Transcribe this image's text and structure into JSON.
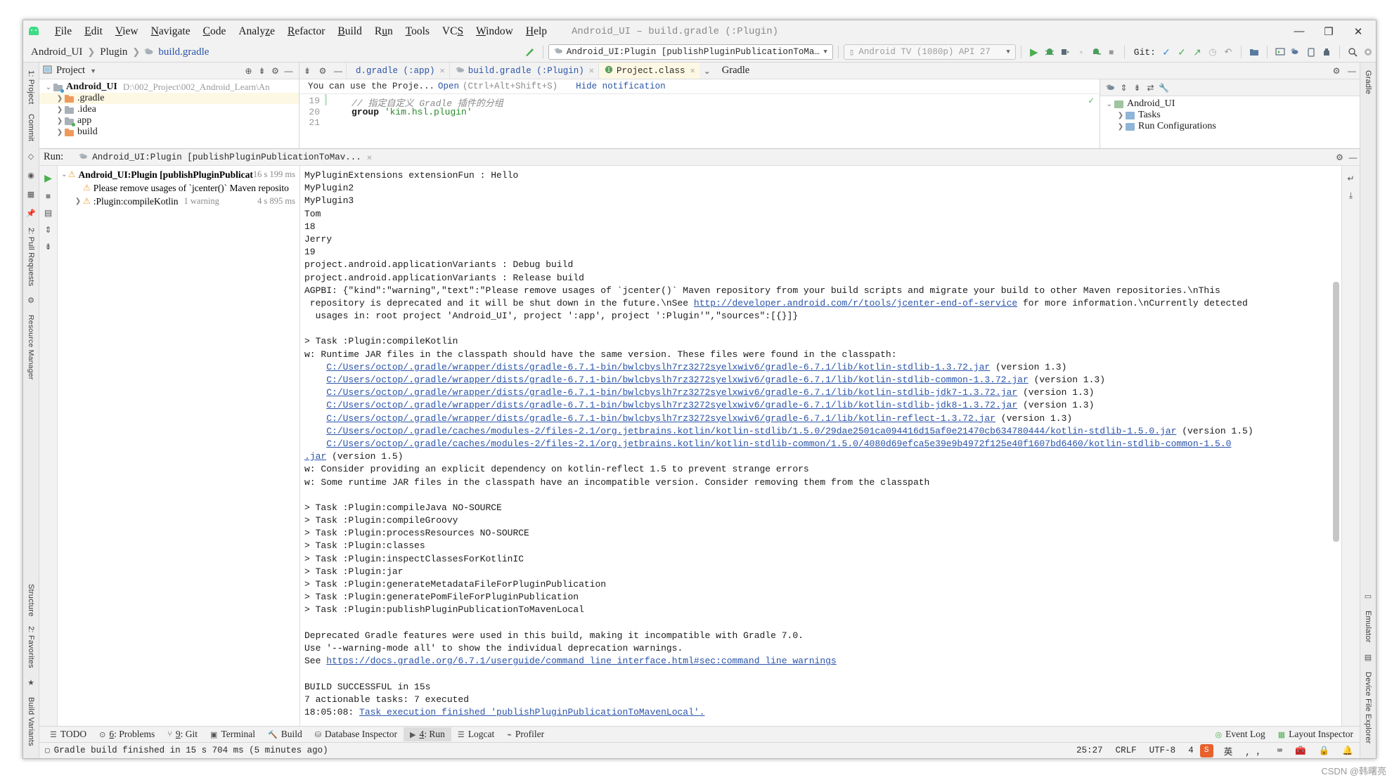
{
  "window": {
    "title": "Android_UI – build.gradle (:Plugin)",
    "minimize": "—",
    "maximize": "❐",
    "close": "✕"
  },
  "menu": {
    "items": [
      "File",
      "Edit",
      "View",
      "Navigate",
      "Code",
      "Analyze",
      "Refactor",
      "Build",
      "Run",
      "Tools",
      "VCS",
      "Window",
      "Help"
    ]
  },
  "navbar": {
    "breadcrumb": [
      "Android_UI",
      "Plugin",
      "build.gradle"
    ],
    "run_config": "Android_UI:Plugin [publishPluginPublicationToMavenLocal]",
    "device": "Android TV (1080p) API 27",
    "git_label": "Git:"
  },
  "project_pane": {
    "title": "Project",
    "tree": [
      {
        "label": "Android_UI",
        "path": "D:\\002_Project\\002_Android_Learn\\An",
        "bold": true,
        "expanded": true,
        "indent": 0,
        "folder": "module",
        "selected": false
      },
      {
        "label": ".gradle",
        "path": "",
        "bold": false,
        "expanded": false,
        "indent": 1,
        "folder": "orange",
        "selected": true
      },
      {
        "label": ".idea",
        "path": "",
        "bold": false,
        "expanded": false,
        "indent": 1,
        "folder": "plain",
        "selected": false
      },
      {
        "label": "app",
        "path": "",
        "bold": false,
        "expanded": false,
        "indent": 1,
        "folder": "module",
        "selected": false
      },
      {
        "label": "build",
        "path": "",
        "bold": false,
        "expanded": false,
        "indent": 1,
        "folder": "orange",
        "selected": false
      }
    ]
  },
  "editor": {
    "tabs": [
      {
        "label": "d.gradle (:app)",
        "icon": "gradle-icon",
        "active": false
      },
      {
        "label": "build.gradle (:Plugin)",
        "icon": "gradle-icon",
        "active": false
      },
      {
        "label": "Project.class",
        "icon": "class-icon",
        "active": true
      }
    ],
    "notification": {
      "text": "You can use the Proje...",
      "link": "Open",
      "shortcut": "(Ctrl+Alt+Shift+S)",
      "hide": "Hide notification"
    },
    "lines": [
      {
        "no": "19",
        "text": "// 指定自定义 Gradle 插件的分组",
        "type": "comment"
      },
      {
        "no": "20",
        "text": "group 'kim.hsl.plugin'",
        "type": "code"
      },
      {
        "no": "21",
        "text": "",
        "type": "code"
      }
    ]
  },
  "gradle_pane": {
    "title": "Gradle",
    "tree": [
      {
        "label": "Android_UI",
        "indent": 0,
        "icon": "elephant-icon"
      },
      {
        "label": "Tasks",
        "indent": 1,
        "icon": "folder-icon"
      },
      {
        "label": "Run Configurations",
        "indent": 1,
        "icon": "folder-icon"
      }
    ]
  },
  "run_panel": {
    "label": "Run:",
    "tab_title": "Android_UI:Plugin [publishPluginPublicationToMav...",
    "tree": [
      {
        "label": "Android_UI:Plugin [publishPluginPublicat",
        "time": "16 s 199 ms",
        "indent": 0,
        "warn": true,
        "expandable": true
      },
      {
        "label": "Please remove usages of `jcenter()` Maven reposito",
        "time": "",
        "indent": 1,
        "warn": true,
        "expandable": false
      },
      {
        "label": ":Plugin:compileKotlin",
        "warncount": "1 warning",
        "time": "4 s 895 ms",
        "indent": 1,
        "warn": true,
        "expandable": true
      }
    ],
    "console": [
      {
        "t": "MyPluginExtensions extensionFun : Hello"
      },
      {
        "t": "MyPlugin2"
      },
      {
        "t": "MyPlugin3"
      },
      {
        "t": "Tom"
      },
      {
        "t": "18"
      },
      {
        "t": "Jerry"
      },
      {
        "t": "19"
      },
      {
        "t": "project.android.applicationVariants : Debug build"
      },
      {
        "t": "project.android.applicationVariants : Release build"
      },
      {
        "t": "AGPBI: {\"kind\":\"warning\",\"text\":\"Please remove usages of `jcenter()` Maven repository from your build scripts and migrate your build to other Maven repositories.\\nThis"
      },
      {
        "t": " repository is deprecated and it will be shut down in the future.\\nSee ",
        "link": "http://developer.android.com/r/tools/jcenter-end-of-service",
        "after": " for more information.\\nCurrently detected"
      },
      {
        "t": "  usages in: root project 'Android_UI', project ':app', project ':Plugin'\",\"sources\":[{}]}"
      },
      {
        "t": ""
      },
      {
        "t": "> Task :Plugin:compileKotlin"
      },
      {
        "t": "w: Runtime JAR files in the classpath should have the same version. These files were found in the classpath:"
      },
      {
        "t": "    ",
        "link": "C:/Users/octop/.gradle/wrapper/dists/gradle-6.7.1-bin/bwlcbyslh7rz3272syelxwiv6/gradle-6.7.1/lib/kotlin-stdlib-1.3.72.jar",
        "after": " (version 1.3)"
      },
      {
        "t": "    ",
        "link": "C:/Users/octop/.gradle/wrapper/dists/gradle-6.7.1-bin/bwlcbyslh7rz3272syelxwiv6/gradle-6.7.1/lib/kotlin-stdlib-common-1.3.72.jar",
        "after": " (version 1.3)"
      },
      {
        "t": "    ",
        "link": "C:/Users/octop/.gradle/wrapper/dists/gradle-6.7.1-bin/bwlcbyslh7rz3272syelxwiv6/gradle-6.7.1/lib/kotlin-stdlib-jdk7-1.3.72.jar",
        "after": " (version 1.3)"
      },
      {
        "t": "    ",
        "link": "C:/Users/octop/.gradle/wrapper/dists/gradle-6.7.1-bin/bwlcbyslh7rz3272syelxwiv6/gradle-6.7.1/lib/kotlin-stdlib-jdk8-1.3.72.jar",
        "after": " (version 1.3)"
      },
      {
        "t": "    ",
        "link": "C:/Users/octop/.gradle/wrapper/dists/gradle-6.7.1-bin/bwlcbyslh7rz3272syelxwiv6/gradle-6.7.1/lib/kotlin-reflect-1.3.72.jar",
        "after": " (version 1.3)"
      },
      {
        "t": "    ",
        "link": "C:/Users/octop/.gradle/caches/modules-2/files-2.1/org.jetbrains.kotlin/kotlin-stdlib/1.5.0/29dae2501ca094416d15af0e21470cb634780444/kotlin-stdlib-1.5.0.jar",
        "after": " (version 1.5)"
      },
      {
        "t": "    ",
        "link": "C:/Users/octop/.gradle/caches/modules-2/files-2.1/org.jetbrains.kotlin/kotlin-stdlib-common/1.5.0/4080d69efca5e39e9b4972f125e40f1607bd6460/kotlin-stdlib-common-1.5.0",
        "after": ""
      },
      {
        "t": "",
        "link": ".jar",
        "after": " (version 1.5)"
      },
      {
        "t": "w: Consider providing an explicit dependency on kotlin-reflect 1.5 to prevent strange errors"
      },
      {
        "t": "w: Some runtime JAR files in the classpath have an incompatible version. Consider removing them from the classpath"
      },
      {
        "t": ""
      },
      {
        "t": "> Task :Plugin:compileJava NO-SOURCE"
      },
      {
        "t": "> Task :Plugin:compileGroovy"
      },
      {
        "t": "> Task :Plugin:processResources NO-SOURCE"
      },
      {
        "t": "> Task :Plugin:classes"
      },
      {
        "t": "> Task :Plugin:inspectClassesForKotlinIC"
      },
      {
        "t": "> Task :Plugin:jar"
      },
      {
        "t": "> Task :Plugin:generateMetadataFileForPluginPublication"
      },
      {
        "t": "> Task :Plugin:generatePomFileForPluginPublication"
      },
      {
        "t": "> Task :Plugin:publishPluginPublicationToMavenLocal"
      },
      {
        "t": ""
      },
      {
        "t": "Deprecated Gradle features were used in this build, making it incompatible with Gradle 7.0."
      },
      {
        "t": "Use '--warning-mode all' to show the individual deprecation warnings."
      },
      {
        "t": "See ",
        "link": "https://docs.gradle.org/6.7.1/userguide/command_line_interface.html#sec:command_line_warnings",
        "after": ""
      },
      {
        "t": ""
      },
      {
        "t": "BUILD SUCCESSFUL in 15s"
      },
      {
        "t": "7 actionable tasks: 7 executed"
      },
      {
        "t": "18:05:08: ",
        "link2": "Task execution finished 'publishPluginPublicationToMavenLocal'."
      }
    ]
  },
  "left_rail": {
    "items": [
      "1: Project",
      "Commit",
      "2: Pull Requests",
      "Structure",
      "2: Favorites",
      "Build Variants"
    ]
  },
  "right_rail": {
    "items": [
      "Gradle",
      "Emulator",
      "Device File Explorer"
    ]
  },
  "toolwindow_bar": {
    "items": [
      {
        "label": "TODO",
        "icon": "list-icon",
        "num": "",
        "active": false
      },
      {
        "label": "Problems",
        "icon": "error-icon",
        "num": "6",
        "active": false
      },
      {
        "label": "Git",
        "icon": "git-icon",
        "num": "9",
        "active": false
      },
      {
        "label": "Terminal",
        "icon": "terminal-icon",
        "num": "",
        "active": false
      },
      {
        "label": "Build",
        "icon": "hammer-icon",
        "num": "",
        "active": false
      },
      {
        "label": "Database Inspector",
        "icon": "database-icon",
        "num": "",
        "active": false
      },
      {
        "label": "Run",
        "icon": "play-icon",
        "num": "4",
        "active": true
      },
      {
        "label": "Logcat",
        "icon": "logcat-icon",
        "num": "",
        "active": false
      },
      {
        "label": "Profiler",
        "icon": "profiler-icon",
        "num": "",
        "active": false
      }
    ],
    "right_items": [
      {
        "label": "Event Log",
        "icon": "event-icon"
      },
      {
        "label": "Layout Inspector",
        "icon": "layout-icon"
      }
    ]
  },
  "status_bar": {
    "message": "Gradle build finished in 15 s 704 ms (5 minutes ago)",
    "caret": "25:27",
    "line_sep": "CRLF",
    "encoding": "UTF-8",
    "indent": "4",
    "ime": "英",
    "lock": "🔒"
  },
  "watermark": "CSDN @韩曙亮"
}
